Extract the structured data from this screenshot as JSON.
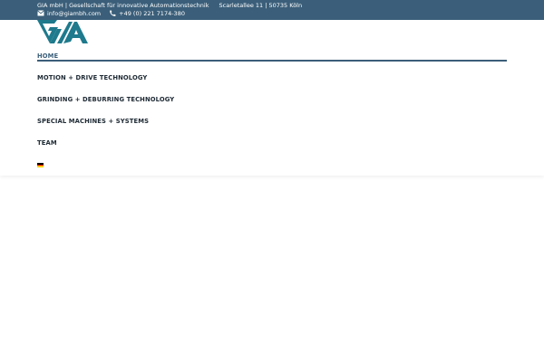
{
  "topbar": {
    "company": "GIA mbH | Gesellschaft für innovative Automationstechnik",
    "address": "Scarletallee 11 | 50735 Köln",
    "email": "info@giambh.com",
    "phone": "+49 (0) 221 7174-380",
    "email_icon": "envelope-icon",
    "phone_icon": "phone-icon"
  },
  "logo": {
    "text": "GIA"
  },
  "nav": {
    "items": [
      {
        "label": "HOME",
        "active": true
      },
      {
        "label": "MOTION + DRIVE TECHNOLOGY"
      },
      {
        "label": "GRINDING + DEBURRING TECHNOLOGY"
      },
      {
        "label": "SPECIAL MACHINES + SYSTEMS"
      },
      {
        "label": "TEAM"
      }
    ],
    "language_flag": "german-flag"
  },
  "colors": {
    "topbar_bg": "#3b5f7a",
    "accent": "#3b5f7a",
    "logo": "#1e7a8c",
    "nav_text": "#1e2a34"
  }
}
